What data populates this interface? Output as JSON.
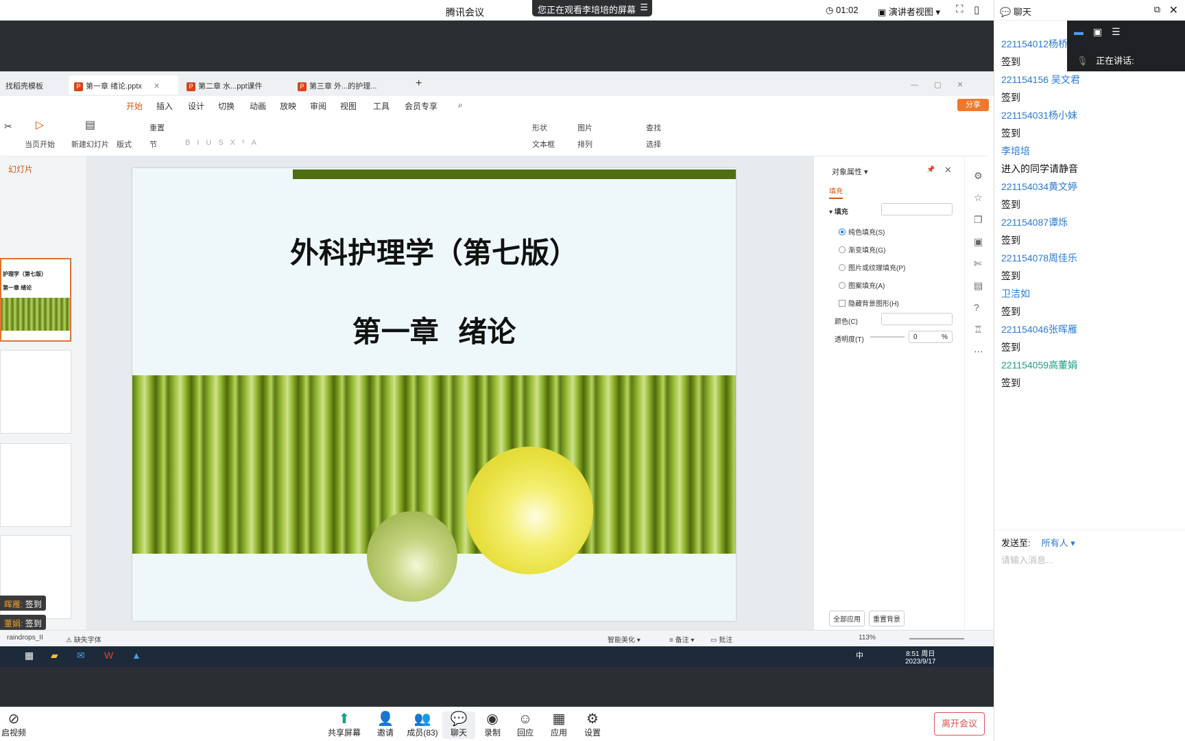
{
  "meeting": {
    "title": "腾讯会议",
    "viewing_banner": "您正在观看李培培的屏幕",
    "timer": "01:02",
    "presenter_view": "演讲者视图"
  },
  "chat": {
    "title": "聊天",
    "speaking_label": "正在讲话:",
    "messages": [
      {
        "name": "221154012杨桥",
        "text": "签到"
      },
      {
        "name": "221154156 吴文君",
        "text": "签到"
      },
      {
        "name": "221154031杨小妹",
        "text": "签到"
      },
      {
        "name": "李培培",
        "text": "进入的同学请静音"
      },
      {
        "name": "221154034黄文婷",
        "text": "签到"
      },
      {
        "name": "221154087谭烁",
        "text": "签到"
      },
      {
        "name": "221154078周佳乐",
        "text": "签到"
      },
      {
        "name": "卫洁如",
        "text": "签到"
      },
      {
        "name": "221154046张晖雁",
        "text": "签到"
      },
      {
        "name": "221154059高董娟",
        "text": "签到"
      }
    ],
    "send_to_label": "发送至:",
    "send_to_value": "所有人",
    "input_placeholder": "请输入消息..."
  },
  "wps": {
    "tabs": [
      "找稻壳模板",
      "第一章 绪论.pptx",
      "第二章 水...ppt课件",
      "第三章 外...的护理..."
    ],
    "menus": [
      "开始",
      "插入",
      "设计",
      "切换",
      "动画",
      "放映",
      "审阅",
      "视图",
      "工具",
      "会员专享"
    ],
    "share": "分享",
    "ribbon": {
      "from_current": "当页开始",
      "new_slide": "新建幻灯片",
      "layout": "版式",
      "section": "节",
      "reset": "重置",
      "shape": "形状",
      "picture": "图片",
      "textbox": "文本框",
      "arrange": "排列",
      "find": "查找",
      "select": "选择"
    },
    "thumbs_header": "幻灯片",
    "thumb1_title": "护理学（第七版）",
    "thumb1_sub": "第一章 绪论",
    "slide": {
      "title": "外科护理学（第七版）",
      "subtitle": "第一章  绪论"
    },
    "props": {
      "header": "对象属性",
      "tab": "填充",
      "section": "填充",
      "options": [
        "纯色填充(S)",
        "渐变填充(G)",
        "图片或纹理填充(P)",
        "图案填充(A)"
      ],
      "hide_bg": "隐藏背景图形(H)",
      "color_label": "颜色(C)",
      "transparency_label": "透明度(T)",
      "transparency_value": "0",
      "percent": "%",
      "apply_all": "全部应用",
      "reset_bg": "重置背景"
    },
    "status": {
      "missing_font": "缺失字体",
      "beautify": "智能美化",
      "notes": "备注",
      "comments": "批注",
      "zoom": "113%",
      "raindrops": "raindrops_II"
    }
  },
  "taskbar": {
    "time": "8:51 周日",
    "date": "2023/9/17",
    "ime": "中"
  },
  "toasts": [
    {
      "name": "晖雁:",
      "text": "签到"
    },
    {
      "name": "董娟:",
      "text": "签到"
    }
  ],
  "toolbar": {
    "video": "启视频",
    "share_screen": "共享屏幕",
    "invite": "邀请",
    "members": "成员(83)",
    "chat": "聊天",
    "record": "录制",
    "reply": "回应",
    "apps": "应用",
    "settings": "设置",
    "leave": "离开会议"
  }
}
